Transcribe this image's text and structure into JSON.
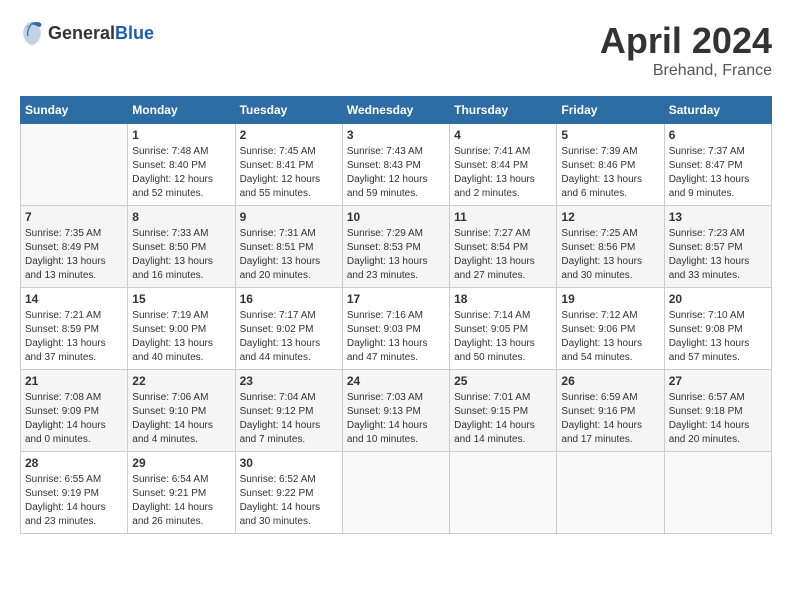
{
  "header": {
    "logo_general": "General",
    "logo_blue": "Blue",
    "month_year": "April 2024",
    "location": "Brehand, France"
  },
  "days_of_week": [
    "Sunday",
    "Monday",
    "Tuesday",
    "Wednesday",
    "Thursday",
    "Friday",
    "Saturday"
  ],
  "weeks": [
    [
      {
        "num": "",
        "info": ""
      },
      {
        "num": "1",
        "info": "Sunrise: 7:48 AM\nSunset: 8:40 PM\nDaylight: 12 hours\nand 52 minutes."
      },
      {
        "num": "2",
        "info": "Sunrise: 7:45 AM\nSunset: 8:41 PM\nDaylight: 12 hours\nand 55 minutes."
      },
      {
        "num": "3",
        "info": "Sunrise: 7:43 AM\nSunset: 8:43 PM\nDaylight: 12 hours\nand 59 minutes."
      },
      {
        "num": "4",
        "info": "Sunrise: 7:41 AM\nSunset: 8:44 PM\nDaylight: 13 hours\nand 2 minutes."
      },
      {
        "num": "5",
        "info": "Sunrise: 7:39 AM\nSunset: 8:46 PM\nDaylight: 13 hours\nand 6 minutes."
      },
      {
        "num": "6",
        "info": "Sunrise: 7:37 AM\nSunset: 8:47 PM\nDaylight: 13 hours\nand 9 minutes."
      }
    ],
    [
      {
        "num": "7",
        "info": "Sunrise: 7:35 AM\nSunset: 8:49 PM\nDaylight: 13 hours\nand 13 minutes."
      },
      {
        "num": "8",
        "info": "Sunrise: 7:33 AM\nSunset: 8:50 PM\nDaylight: 13 hours\nand 16 minutes."
      },
      {
        "num": "9",
        "info": "Sunrise: 7:31 AM\nSunset: 8:51 PM\nDaylight: 13 hours\nand 20 minutes."
      },
      {
        "num": "10",
        "info": "Sunrise: 7:29 AM\nSunset: 8:53 PM\nDaylight: 13 hours\nand 23 minutes."
      },
      {
        "num": "11",
        "info": "Sunrise: 7:27 AM\nSunset: 8:54 PM\nDaylight: 13 hours\nand 27 minutes."
      },
      {
        "num": "12",
        "info": "Sunrise: 7:25 AM\nSunset: 8:56 PM\nDaylight: 13 hours\nand 30 minutes."
      },
      {
        "num": "13",
        "info": "Sunrise: 7:23 AM\nSunset: 8:57 PM\nDaylight: 13 hours\nand 33 minutes."
      }
    ],
    [
      {
        "num": "14",
        "info": "Sunrise: 7:21 AM\nSunset: 8:59 PM\nDaylight: 13 hours\nand 37 minutes."
      },
      {
        "num": "15",
        "info": "Sunrise: 7:19 AM\nSunset: 9:00 PM\nDaylight: 13 hours\nand 40 minutes."
      },
      {
        "num": "16",
        "info": "Sunrise: 7:17 AM\nSunset: 9:02 PM\nDaylight: 13 hours\nand 44 minutes."
      },
      {
        "num": "17",
        "info": "Sunrise: 7:16 AM\nSunset: 9:03 PM\nDaylight: 13 hours\nand 47 minutes."
      },
      {
        "num": "18",
        "info": "Sunrise: 7:14 AM\nSunset: 9:05 PM\nDaylight: 13 hours\nand 50 minutes."
      },
      {
        "num": "19",
        "info": "Sunrise: 7:12 AM\nSunset: 9:06 PM\nDaylight: 13 hours\nand 54 minutes."
      },
      {
        "num": "20",
        "info": "Sunrise: 7:10 AM\nSunset: 9:08 PM\nDaylight: 13 hours\nand 57 minutes."
      }
    ],
    [
      {
        "num": "21",
        "info": "Sunrise: 7:08 AM\nSunset: 9:09 PM\nDaylight: 14 hours\nand 0 minutes."
      },
      {
        "num": "22",
        "info": "Sunrise: 7:06 AM\nSunset: 9:10 PM\nDaylight: 14 hours\nand 4 minutes."
      },
      {
        "num": "23",
        "info": "Sunrise: 7:04 AM\nSunset: 9:12 PM\nDaylight: 14 hours\nand 7 minutes."
      },
      {
        "num": "24",
        "info": "Sunrise: 7:03 AM\nSunset: 9:13 PM\nDaylight: 14 hours\nand 10 minutes."
      },
      {
        "num": "25",
        "info": "Sunrise: 7:01 AM\nSunset: 9:15 PM\nDaylight: 14 hours\nand 14 minutes."
      },
      {
        "num": "26",
        "info": "Sunrise: 6:59 AM\nSunset: 9:16 PM\nDaylight: 14 hours\nand 17 minutes."
      },
      {
        "num": "27",
        "info": "Sunrise: 6:57 AM\nSunset: 9:18 PM\nDaylight: 14 hours\nand 20 minutes."
      }
    ],
    [
      {
        "num": "28",
        "info": "Sunrise: 6:55 AM\nSunset: 9:19 PM\nDaylight: 14 hours\nand 23 minutes."
      },
      {
        "num": "29",
        "info": "Sunrise: 6:54 AM\nSunset: 9:21 PM\nDaylight: 14 hours\nand 26 minutes."
      },
      {
        "num": "30",
        "info": "Sunrise: 6:52 AM\nSunset: 9:22 PM\nDaylight: 14 hours\nand 30 minutes."
      },
      {
        "num": "",
        "info": ""
      },
      {
        "num": "",
        "info": ""
      },
      {
        "num": "",
        "info": ""
      },
      {
        "num": "",
        "info": ""
      }
    ]
  ]
}
